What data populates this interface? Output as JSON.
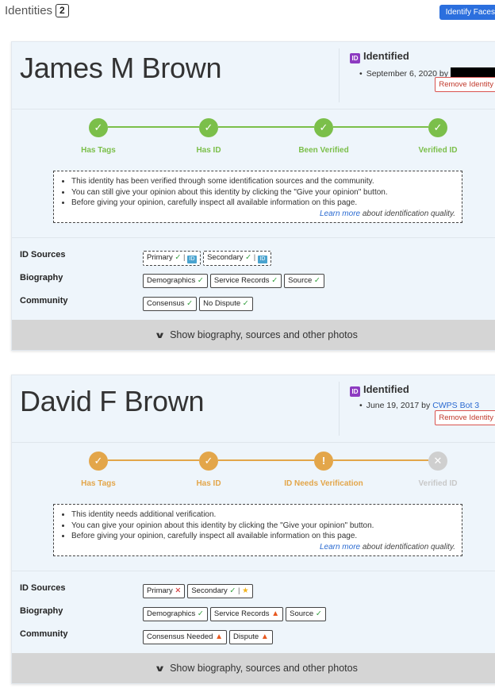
{
  "header": {
    "title": "Identities",
    "count": "2",
    "identify_button": "Identify Faces"
  },
  "cards": [
    {
      "name": "James M Brown",
      "status_title": "Identified",
      "status_icon": "ID",
      "status_date": "September 6, 2020 by",
      "status_by": "",
      "remove_label": "Remove Identity",
      "steps": [
        {
          "label": "Has Tags",
          "state": "done",
          "icon": "✓"
        },
        {
          "label": "Has ID",
          "state": "done",
          "icon": "✓"
        },
        {
          "label": "Been Verified",
          "state": "done",
          "icon": "✓"
        },
        {
          "label": "Verified ID",
          "state": "done",
          "icon": "✓"
        }
      ],
      "info": [
        "This identity has been verified through some identification sources and the community.",
        "You can still give your opinion about this identity by clicking the \"Give your opinion\" button.",
        "Before giving your opinion, carefully inspect all available information on this page."
      ],
      "learn_link": "Learn more",
      "learn_rest": " about identification quality.",
      "rows": [
        {
          "label": "ID Sources",
          "tags": [
            {
              "text": "Primary",
              "mark": "✓",
              "extra": "▣"
            },
            {
              "text": "Secondary",
              "mark": "✓",
              "extra": "▣"
            }
          ]
        },
        {
          "label": "Biography",
          "tags": [
            {
              "text": "Demographics",
              "mark": "✓"
            },
            {
              "text": "Service Records",
              "mark": "✓"
            },
            {
              "text": "Source",
              "mark": "✓"
            }
          ]
        },
        {
          "label": "Community",
          "tags": [
            {
              "text": "Consensus",
              "mark": "✓"
            },
            {
              "text": "No Dispute",
              "mark": "✓"
            }
          ]
        }
      ],
      "expand_label": "Show biography, sources and other photos"
    },
    {
      "name": "David F Brown",
      "status_title": "Identified",
      "status_icon": "ID",
      "status_date": "June 19, 2017 by",
      "status_by": "CWPS Bot 3",
      "remove_label": "Remove Identity",
      "steps": [
        {
          "label": "Has Tags",
          "state": "done",
          "icon": "✓"
        },
        {
          "label": "Has ID",
          "state": "done",
          "icon": "✓"
        },
        {
          "label": "ID Needs Verification",
          "state": "warn",
          "icon": "!"
        },
        {
          "label": "Verified ID",
          "state": "inactive",
          "icon": "✕"
        }
      ],
      "info": [
        "This identity needs additional verification.",
        "You can give your opinion about this identity by clicking the \"Give your opinion\" button.",
        "Before giving your opinion, carefully inspect all available information on this page."
      ],
      "learn_link": "Learn more",
      "learn_rest": " about identification quality.",
      "rows": [
        {
          "label": "ID Sources",
          "tags": [
            {
              "text": "Primary",
              "mark": "✕"
            },
            {
              "text": "Secondary",
              "mark": "✓",
              "extra": "★"
            }
          ]
        },
        {
          "label": "Biography",
          "tags": [
            {
              "text": "Demographics",
              "mark": "✓"
            },
            {
              "text": "Service Records",
              "mark": "▲"
            },
            {
              "text": "Source",
              "mark": "✓"
            }
          ]
        },
        {
          "label": "Community",
          "tags": [
            {
              "text": "Consensus Needed",
              "mark": "▲"
            },
            {
              "text": "Dispute",
              "mark": "▲"
            }
          ]
        }
      ],
      "expand_label": "Show biography, sources and other photos"
    }
  ],
  "colors": {
    "step_done_card1": "#7bbf4a",
    "step_done_card2": "#e3a64a",
    "step_inactive": "#cfcfcf",
    "link": "#2a6ad1"
  }
}
